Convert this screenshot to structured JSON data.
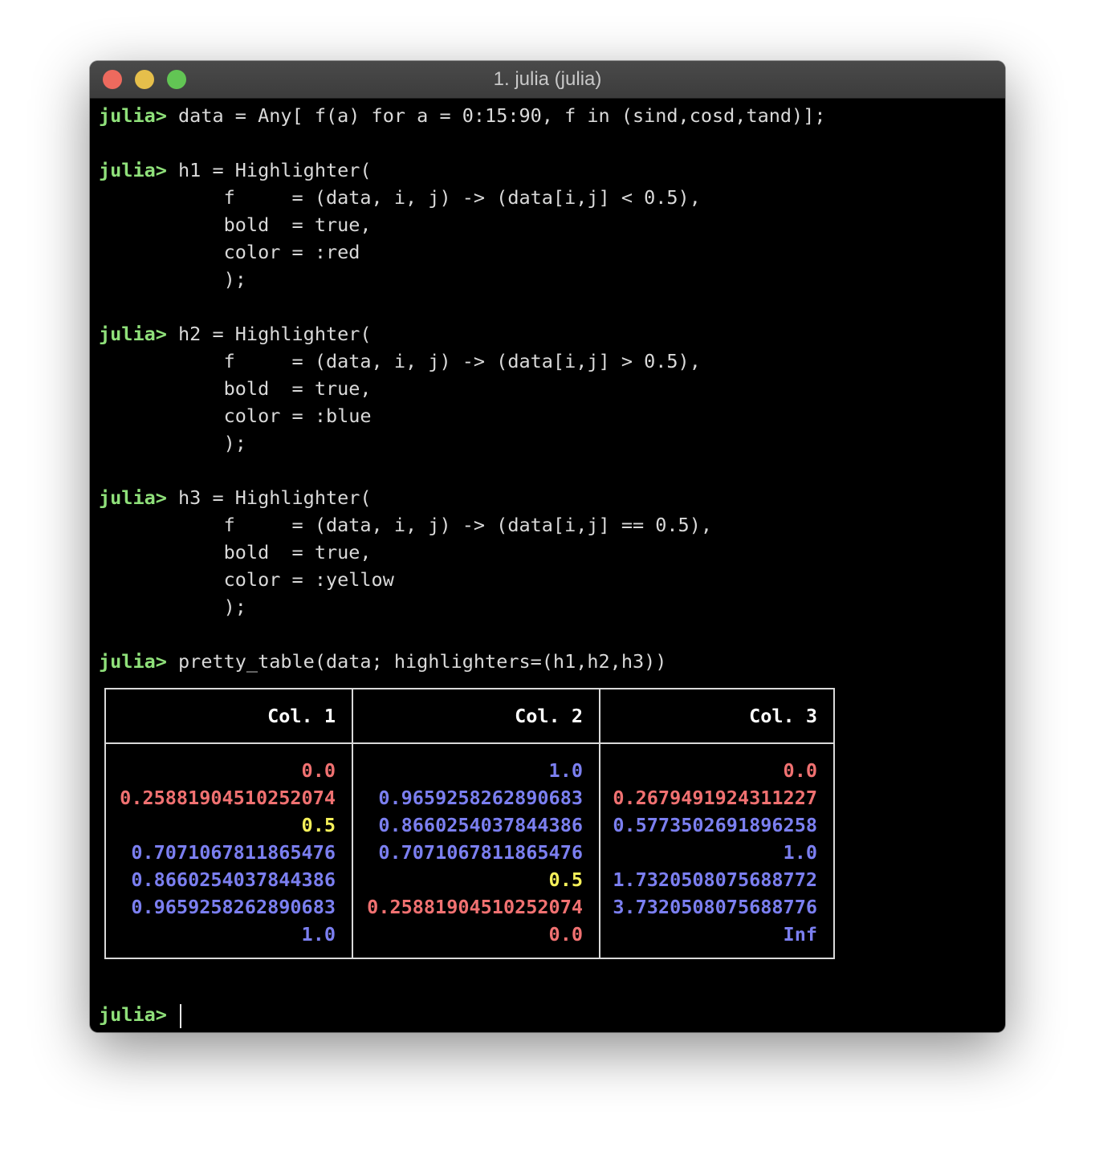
{
  "window": {
    "title": "1. julia (julia)",
    "traffic_lights": {
      "close_color": "#ed6a5e",
      "minimize_color": "#e6bf4b",
      "maximize_color": "#62c554"
    }
  },
  "colors": {
    "prompt": "#8fe07a",
    "text": "#d9d9d9",
    "red": "#f07171",
    "blue": "#7b7ff0",
    "yellow": "#f5f05a"
  },
  "terminal": {
    "prompt": "julia>",
    "lines": [
      {
        "prompt": true,
        "code": " data = Any[ f(a) for a = 0:15:90, f in (sind,cosd,tand)];"
      },
      {
        "prompt": false,
        "code": ""
      },
      {
        "prompt": true,
        "code": " h1 = Highlighter("
      },
      {
        "prompt": false,
        "code": "           f     = (data, i, j) -> (data[i,j] < 0.5),"
      },
      {
        "prompt": false,
        "code": "           bold  = true,"
      },
      {
        "prompt": false,
        "code": "           color = :red"
      },
      {
        "prompt": false,
        "code": "           );"
      },
      {
        "prompt": false,
        "code": ""
      },
      {
        "prompt": true,
        "code": " h2 = Highlighter("
      },
      {
        "prompt": false,
        "code": "           f     = (data, i, j) -> (data[i,j] > 0.5),"
      },
      {
        "prompt": false,
        "code": "           bold  = true,"
      },
      {
        "prompt": false,
        "code": "           color = :blue"
      },
      {
        "prompt": false,
        "code": "           );"
      },
      {
        "prompt": false,
        "code": ""
      },
      {
        "prompt": true,
        "code": " h3 = Highlighter("
      },
      {
        "prompt": false,
        "code": "           f     = (data, i, j) -> (data[i,j] == 0.5),"
      },
      {
        "prompt": false,
        "code": "           bold  = true,"
      },
      {
        "prompt": false,
        "code": "           color = :yellow"
      },
      {
        "prompt": false,
        "code": "           );"
      },
      {
        "prompt": false,
        "code": ""
      },
      {
        "prompt": true,
        "code": " pretty_table(data; highlighters=(h1,h2,h3))"
      }
    ],
    "final_prompt": "julia>"
  },
  "table": {
    "headers": [
      "Col. 1",
      "Col. 2",
      "Col. 3"
    ],
    "columns": [
      [
        {
          "text": "0.0",
          "color": "red"
        },
        {
          "text": "0.25881904510252074",
          "color": "red"
        },
        {
          "text": "0.5",
          "color": "yellow"
        },
        {
          "text": "0.7071067811865476",
          "color": "blue"
        },
        {
          "text": "0.8660254037844386",
          "color": "blue"
        },
        {
          "text": "0.9659258262890683",
          "color": "blue"
        },
        {
          "text": "1.0",
          "color": "blue"
        }
      ],
      [
        {
          "text": "1.0",
          "color": "blue"
        },
        {
          "text": "0.9659258262890683",
          "color": "blue"
        },
        {
          "text": "0.8660254037844386",
          "color": "blue"
        },
        {
          "text": "0.7071067811865476",
          "color": "blue"
        },
        {
          "text": "0.5",
          "color": "yellow"
        },
        {
          "text": "0.25881904510252074",
          "color": "red"
        },
        {
          "text": "0.0",
          "color": "red"
        }
      ],
      [
        {
          "text": "0.0",
          "color": "red"
        },
        {
          "text": "0.2679491924311227",
          "color": "red"
        },
        {
          "text": "0.5773502691896258",
          "color": "blue"
        },
        {
          "text": "1.0",
          "color": "blue"
        },
        {
          "text": "1.7320508075688772",
          "color": "blue"
        },
        {
          "text": "3.7320508075688776",
          "color": "blue"
        },
        {
          "text": "Inf",
          "color": "blue"
        }
      ]
    ]
  }
}
